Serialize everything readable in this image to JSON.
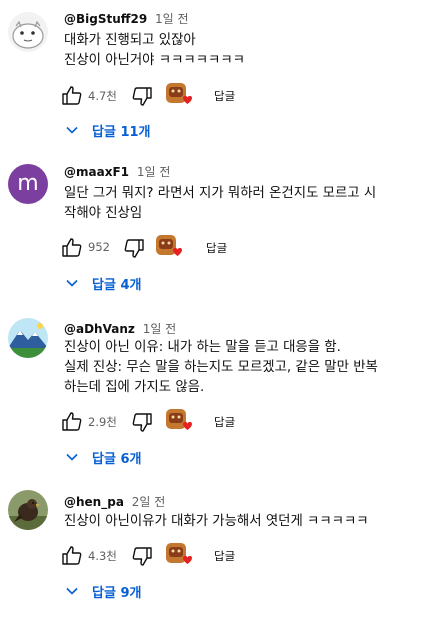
{
  "comments": [
    {
      "author": "@BigStuff29",
      "time": "1일 전",
      "lines": [
        "대화가 진행되고 있잖아",
        "진상이 아닌거야 ㅋㅋㅋㅋㅋㅋㅋ"
      ],
      "likes": "4.7천",
      "reply_label": "답글",
      "replies_label": "답글 11개",
      "avatar_icon": "cartoon-creature-avatar"
    },
    {
      "author": "@maaxF1",
      "time": "1일 전",
      "lines": [
        "일단 그거 뭐지? 라면서 지가 뭐하러 온건지도 모르고 시",
        "작해야 진상임"
      ],
      "likes": "952",
      "reply_label": "답글",
      "replies_label": "답글 4개",
      "avatar_letter": "m",
      "avatar_color": "#7b3fa0"
    },
    {
      "author": "@aDhVanz",
      "time": "1일 전",
      "lines": [
        "진상이 아닌 이유: 내가 하는 말을 듣고 대응을 함.",
        "실제 진상: 무슨 말을 하는지도 모르겠고, 같은 말만 반복",
        "하는데 집에 가지도 않음."
      ],
      "likes": "2.9천",
      "reply_label": "답글",
      "replies_label": "답글 6개",
      "avatar_icon": "mountain-landscape-avatar"
    },
    {
      "author": "@hen_pa",
      "time": "2일 전",
      "lines": [
        "진상이 아닌이유가 대화가 가능해서 엿던게 ㅋㅋㅋㅋㅋ"
      ],
      "likes": "4.3천",
      "reply_label": "답글",
      "replies_label": "답글 9개",
      "avatar_icon": "bird-photo-avatar"
    }
  ],
  "colors": {
    "link_blue": "#065fd4",
    "meta_gray": "#606060",
    "heart_red": "#e52222"
  }
}
